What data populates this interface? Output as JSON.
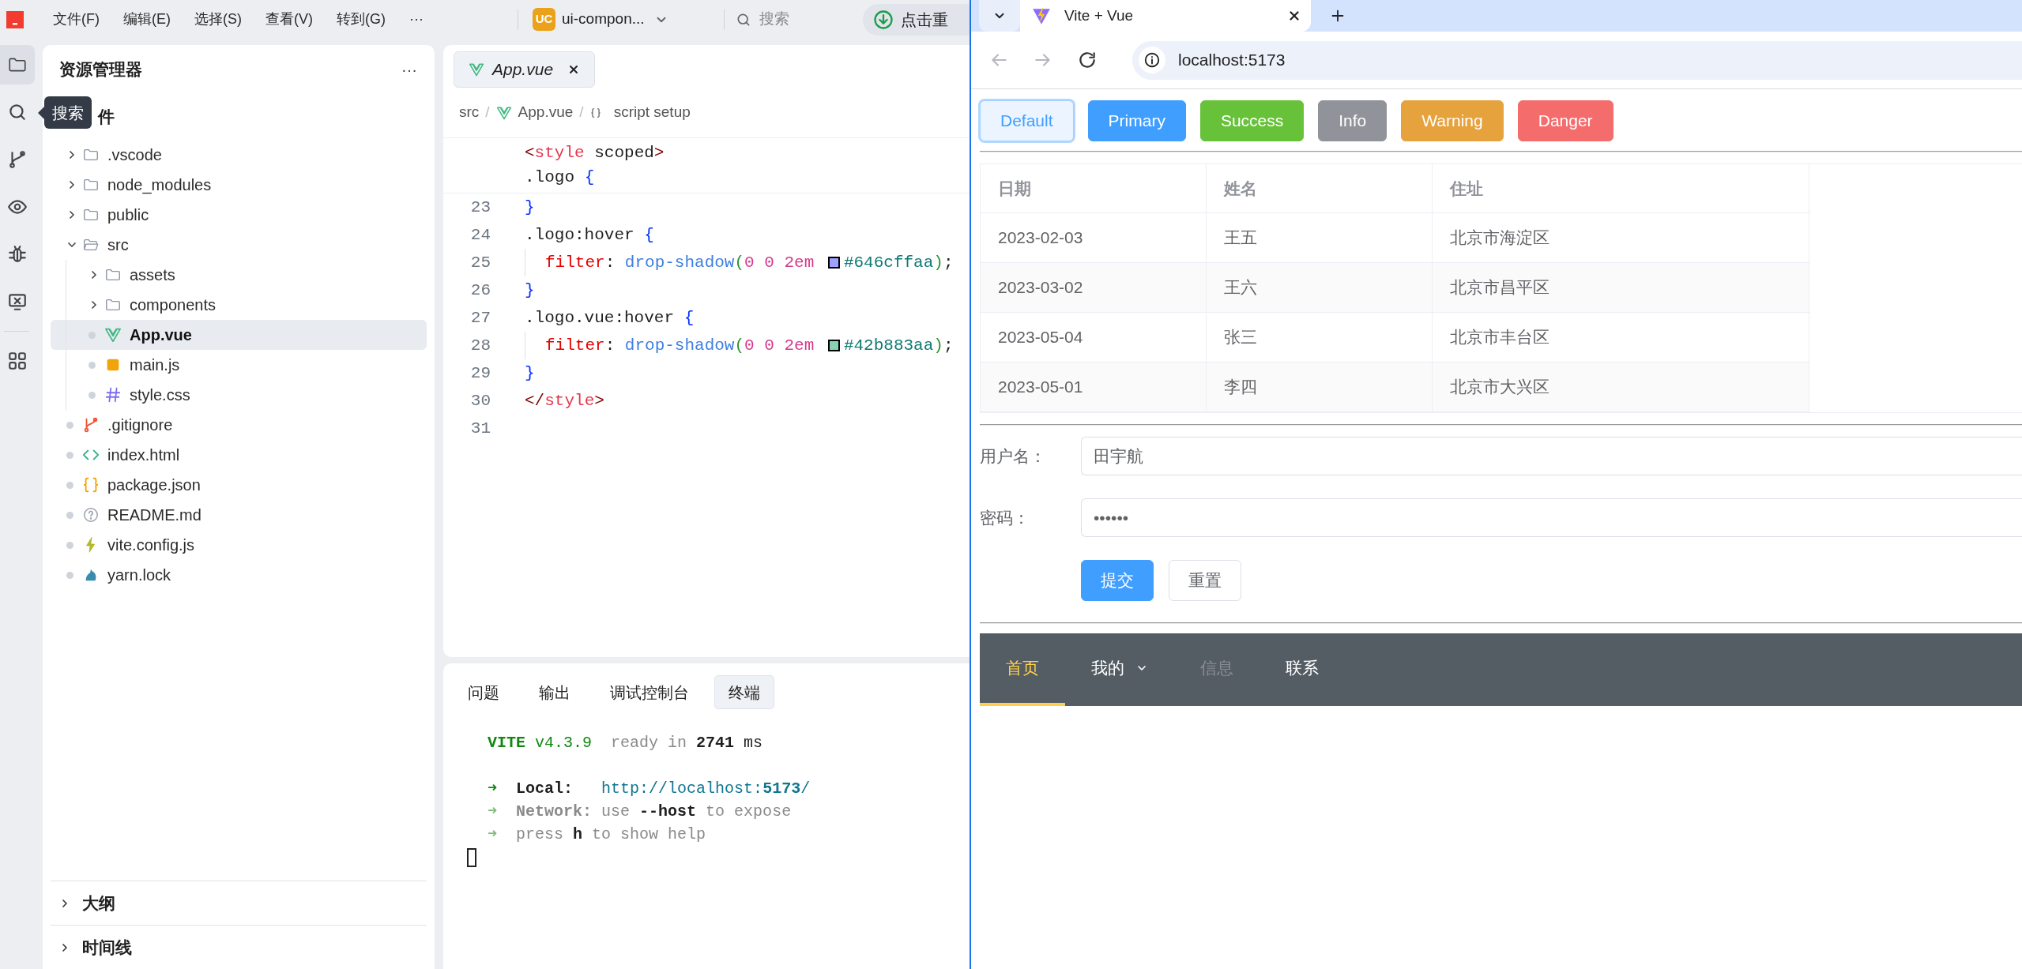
{
  "ide": {
    "menu": [
      "文件(F)",
      "编辑(E)",
      "选择(S)",
      "查看(V)",
      "转到(G)",
      "···"
    ],
    "project": {
      "badge": "UC",
      "name": "ui-compon..."
    },
    "search": {
      "placeholder": "搜索"
    },
    "action_button": {
      "label": "点击重"
    },
    "activity_bar": [
      {
        "kind": "explorer",
        "selected": true
      },
      {
        "kind": "search",
        "selected": false
      },
      {
        "kind": "source-control",
        "selected": false
      },
      {
        "kind": "preview",
        "selected": false
      },
      {
        "kind": "debug",
        "selected": false
      },
      {
        "kind": "remote",
        "selected": false
      },
      {
        "kind": "extensions",
        "selected": false
      }
    ],
    "tooltip": "搜索",
    "explorer": {
      "title": "资源管理器",
      "more": "···",
      "section": "件",
      "tree": [
        {
          "name": ".vscode",
          "kind": "folder",
          "expanded": false,
          "selected": false
        },
        {
          "name": "node_modules",
          "kind": "folder",
          "expanded": false,
          "selected": false
        },
        {
          "name": "public",
          "kind": "folder",
          "expanded": false,
          "selected": false
        },
        {
          "name": "src",
          "kind": "folder",
          "expanded": true,
          "selected": false,
          "children": [
            {
              "name": "assets",
              "kind": "folder",
              "expanded": false,
              "selected": false
            },
            {
              "name": "components",
              "kind": "folder",
              "expanded": false,
              "selected": false
            },
            {
              "name": "App.vue",
              "kind": "vue",
              "selected": true
            },
            {
              "name": "main.js",
              "kind": "javascript",
              "selected": false
            },
            {
              "name": "style.css",
              "kind": "stylesheet",
              "selected": false
            }
          ]
        },
        {
          "name": ".gitignore",
          "kind": "gitignore",
          "selected": false
        },
        {
          "name": "index.html",
          "kind": "html",
          "selected": false
        },
        {
          "name": "package.json",
          "kind": "json",
          "selected": false
        },
        {
          "name": "README.md",
          "kind": "markdown",
          "selected": false
        },
        {
          "name": "vite.config.js",
          "kind": "config",
          "selected": false
        },
        {
          "name": "yarn.lock",
          "kind": "lockfile",
          "selected": false
        }
      ],
      "bottom_sections": [
        {
          "label": "大纲",
          "expanded": false
        },
        {
          "label": "时间线",
          "expanded": false
        }
      ]
    },
    "editor": {
      "tab": {
        "label": "App.vue",
        "kind": "vue",
        "preview": true
      },
      "breadcrumb": {
        "separator": "/",
        "items": [
          {
            "kind": "folder",
            "text": "src"
          },
          {
            "kind": "vue",
            "text": "App.vue"
          },
          {
            "kind": "symbol",
            "text": "script setup"
          }
        ]
      },
      "sticky_lines": [
        {
          "tokens": [
            {
              "kind": "punct",
              "text": "<"
            },
            {
              "kind": "tag",
              "text": "style"
            },
            {
              "kind": "plain",
              "text": " scoped"
            },
            {
              "kind": "punct",
              "text": ">"
            }
          ]
        },
        {
          "tokens": [
            {
              "kind": "selector",
              "text": ".logo "
            },
            {
              "kind": "brace",
              "text": "{"
            }
          ]
        }
      ],
      "lines": [
        {
          "number": "23",
          "indented": false,
          "tokens": [
            {
              "kind": "brace",
              "text": "}"
            }
          ]
        },
        {
          "number": "24",
          "indented": false,
          "tokens": [
            {
              "kind": "selector",
              "text": ".logo:hover "
            },
            {
              "kind": "brace",
              "text": "{"
            }
          ]
        },
        {
          "number": "25",
          "indented": true,
          "tokens": [
            {
              "kind": "property",
              "text": "filter"
            },
            {
              "kind": "plain",
              "text": ": "
            },
            {
              "kind": "function",
              "text": "drop-shadow"
            },
            {
              "kind": "paren",
              "text": "("
            },
            {
              "kind": "number",
              "text": "0 0 2em "
            },
            {
              "kind": "swatch",
              "color": "#9ea1ff"
            },
            {
              "kind": "hex",
              "text": "#646cffaa"
            },
            {
              "kind": "paren",
              "text": ")"
            },
            {
              "kind": "plain",
              "text": ";"
            }
          ]
        },
        {
          "number": "26",
          "indented": false,
          "tokens": [
            {
              "kind": "brace",
              "text": "}"
            }
          ]
        },
        {
          "number": "27",
          "indented": false,
          "tokens": [
            {
              "kind": "selector",
              "text": ".logo.vue:hover "
            },
            {
              "kind": "brace",
              "text": "{"
            }
          ]
        },
        {
          "number": "28",
          "indented": true,
          "tokens": [
            {
              "kind": "property",
              "text": "filter"
            },
            {
              "kind": "plain",
              "text": ": "
            },
            {
              "kind": "function",
              "text": "drop-shadow"
            },
            {
              "kind": "paren",
              "text": "("
            },
            {
              "kind": "number",
              "text": "0 0 2em "
            },
            {
              "kind": "swatch",
              "color": "#86d2b1"
            },
            {
              "kind": "hex",
              "text": "#42b883aa"
            },
            {
              "kind": "paren",
              "text": ")"
            },
            {
              "kind": "plain",
              "text": ";"
            }
          ]
        },
        {
          "number": "29",
          "indented": false,
          "tokens": [
            {
              "kind": "brace",
              "text": "}"
            }
          ]
        },
        {
          "number": "30",
          "indented": false,
          "tokens": [
            {
              "kind": "punct",
              "text": "</"
            },
            {
              "kind": "tag",
              "text": "style"
            },
            {
              "kind": "punct",
              "text": ">"
            }
          ]
        },
        {
          "number": "31",
          "indented": false
        }
      ]
    },
    "panel": {
      "tabs": [
        {
          "label": "问题",
          "selected": false
        },
        {
          "label": "输出",
          "selected": false
        },
        {
          "label": "调试控制台",
          "selected": false
        },
        {
          "label": "终端",
          "selected": true
        }
      ],
      "terminal": [
        {
          "kind": "text",
          "tokens": [
            {
              "kind": "brand",
              "text": "VITE"
            },
            {
              "kind": "accent",
              "text": " v4.3.9"
            },
            {
              "kind": "dim",
              "text": "  ready in "
            },
            {
              "kind": "strong",
              "text": "2741"
            },
            {
              "kind": "plain",
              "text": " ms"
            }
          ]
        },
        {
          "kind": "blank"
        },
        {
          "kind": "text",
          "tokens": [
            {
              "kind": "arrow",
              "text": "➜"
            },
            {
              "kind": "strong",
              "text": "  Local:   "
            },
            {
              "kind": "link",
              "text": "http://localhost:"
            },
            {
              "kind": "link-bold",
              "text": "5173"
            },
            {
              "kind": "link",
              "text": "/"
            }
          ]
        },
        {
          "kind": "text",
          "tokens": [
            {
              "kind": "arrow-dim",
              "text": "➜"
            },
            {
              "kind": "dim-bold",
              "text": "  Network:"
            },
            {
              "kind": "dim",
              "text": " use "
            },
            {
              "kind": "strong",
              "text": "--host"
            },
            {
              "kind": "dim",
              "text": " to expose"
            }
          ]
        },
        {
          "kind": "text",
          "tokens": [
            {
              "kind": "arrow-dim",
              "text": "➜"
            },
            {
              "kind": "dim",
              "text": "  press "
            },
            {
              "kind": "strong",
              "text": "h"
            },
            {
              "kind": "dim",
              "text": " to show help"
            }
          ]
        }
      ]
    }
  },
  "browser": {
    "tab": {
      "title": "Vite + Vue"
    },
    "toolbar": [
      {
        "kind": "back",
        "disabled": true
      },
      {
        "kind": "forward",
        "disabled": true
      },
      {
        "kind": "reload",
        "disabled": false
      }
    ],
    "address": "localhost:5173",
    "buttons": [
      {
        "kind": "default",
        "label": "Default",
        "focused": true
      },
      {
        "kind": "primary",
        "label": "Primary",
        "focused": false
      },
      {
        "kind": "success",
        "label": "Success",
        "focused": false
      },
      {
        "kind": "info",
        "label": "Info",
        "focused": false
      },
      {
        "kind": "warning",
        "label": "Warning",
        "focused": false
      },
      {
        "kind": "danger",
        "label": "Danger",
        "focused": false
      }
    ],
    "table": {
      "columns": [
        "日期",
        "姓名",
        "住址"
      ],
      "rows": [
        [
          "2023-02-03",
          "王五",
          "北京市海淀区"
        ],
        [
          "2023-03-02",
          "王六",
          "北京市昌平区"
        ],
        [
          "2023-05-04",
          "张三",
          "北京市丰台区"
        ],
        [
          "2023-05-01",
          "李四",
          "北京市大兴区"
        ]
      ]
    },
    "form": {
      "fields": [
        {
          "label": "用户名：",
          "value": "田宇航"
        },
        {
          "label": "密码：",
          "value": "••••••"
        }
      ],
      "buttons": [
        {
          "kind": "primary",
          "label": "提交"
        },
        {
          "kind": "default",
          "label": "重置"
        }
      ]
    },
    "menu": [
      {
        "label": "首页",
        "kind": "item",
        "selected": true,
        "disabled": false
      },
      {
        "label": "我的",
        "kind": "submenu",
        "selected": false,
        "disabled": false
      },
      {
        "label": "信息",
        "kind": "item",
        "selected": false,
        "disabled": true
      },
      {
        "label": "联系",
        "kind": "item",
        "selected": false,
        "disabled": false
      }
    ]
  }
}
